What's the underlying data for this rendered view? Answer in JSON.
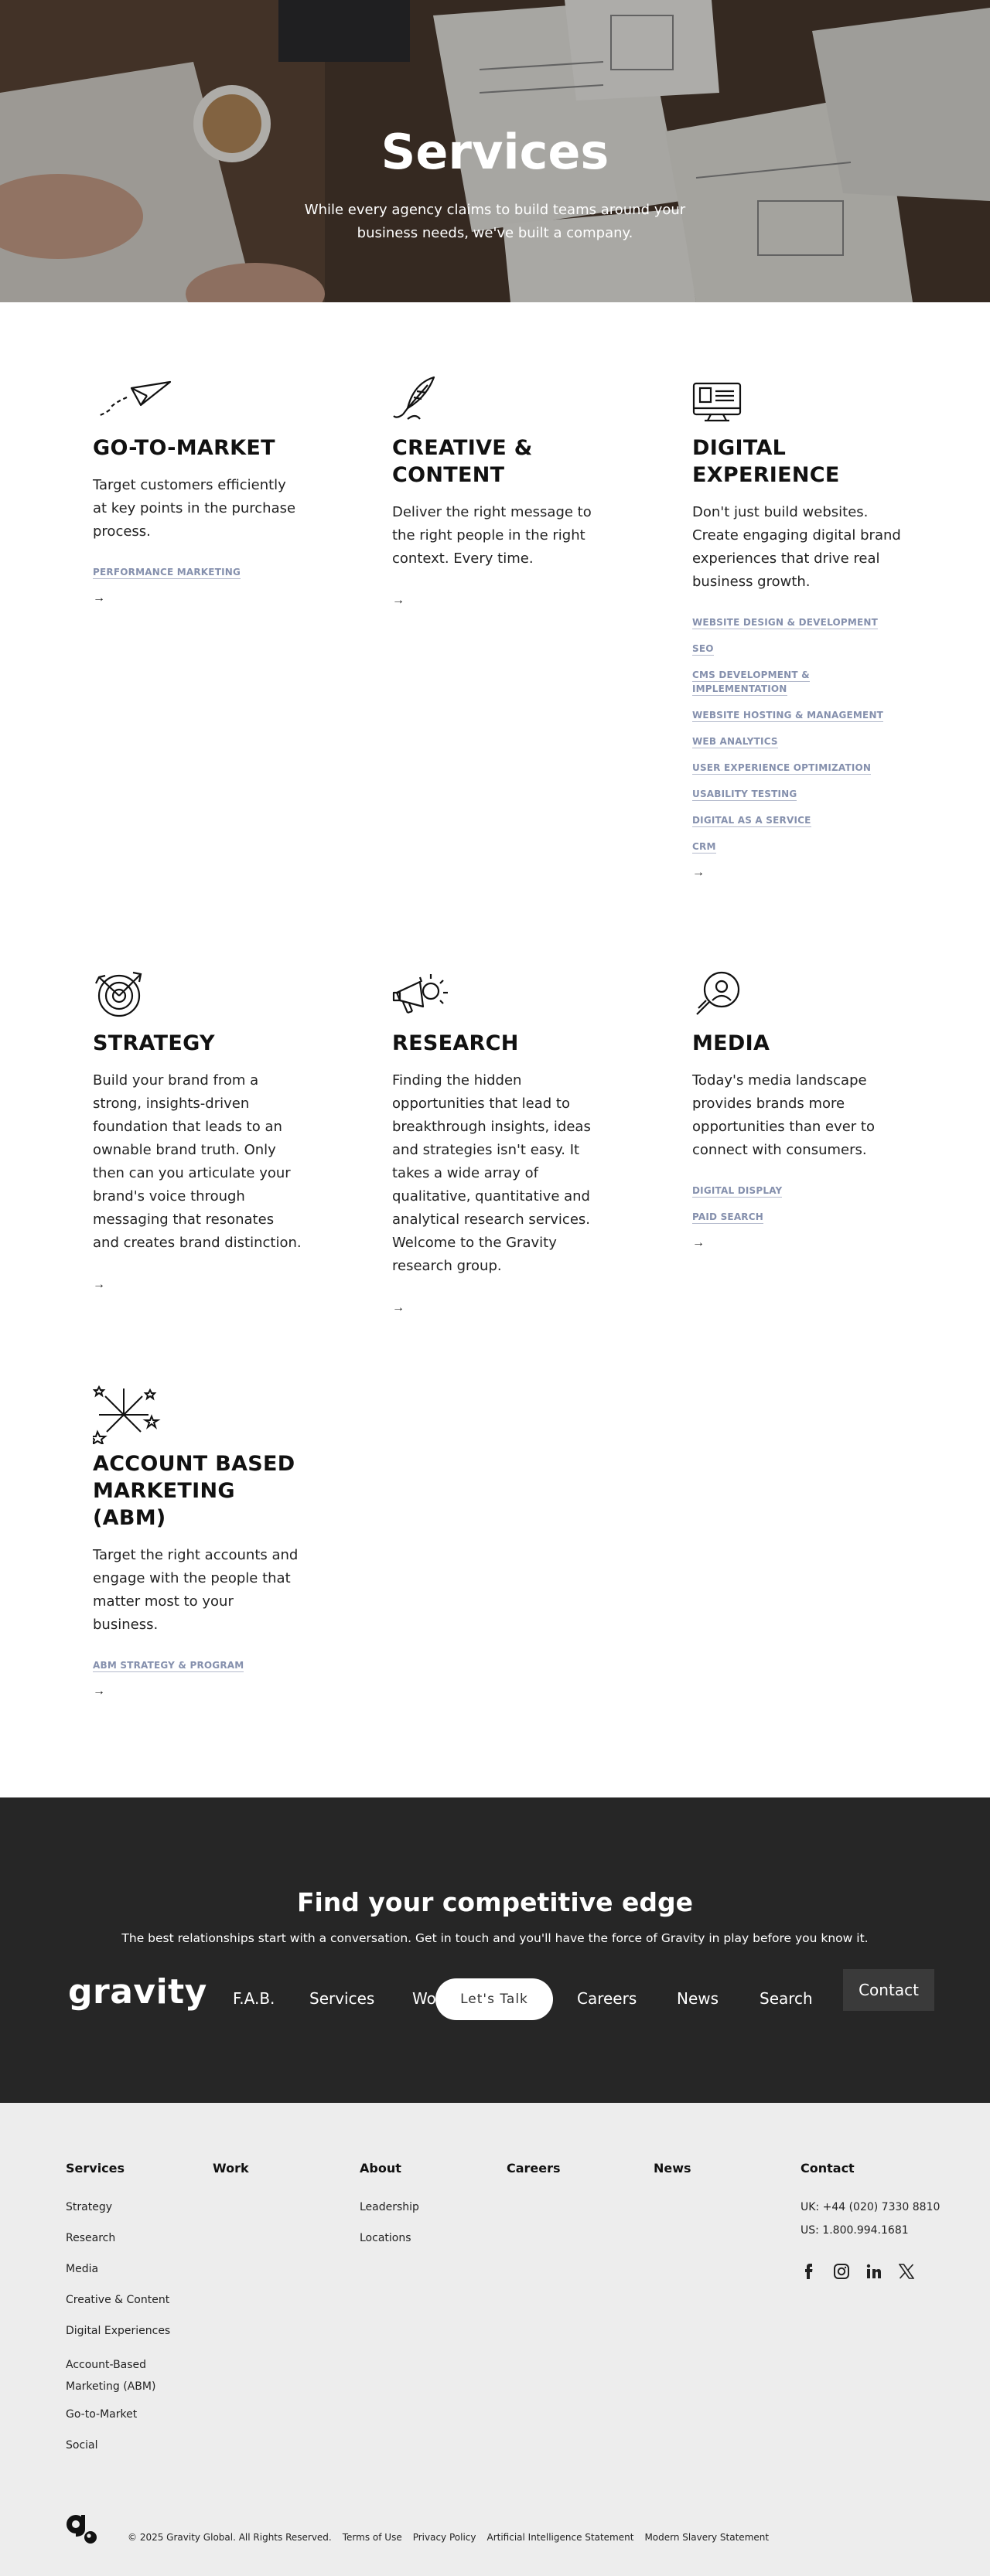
{
  "hero": {
    "title": "Services",
    "subtitle": "While every agency claims to build teams around your business needs, we've built a company."
  },
  "services": [
    {
      "title": "Go-to-Market",
      "icon": "paper-plane-icon",
      "description": "Target customers efficiently at key points in the purchase process.",
      "links": [
        "Performance Marketing"
      ]
    },
    {
      "title": "Creative & Content",
      "icon": "quill-icon",
      "description": "Deliver the right message to the right people in the right context. Every time.",
      "links": []
    },
    {
      "title": "Digital Experience",
      "icon": "monitor-icon",
      "description": "Don't just build websites. Create engaging digital brand experiences that drive real business growth.",
      "links": [
        "Website Design & Development",
        "SEO",
        "CMS Development & Implementation",
        "Website Hosting & Management",
        "Web Analytics",
        "User Experience Optimization",
        "Usability Testing",
        "Digital as a Service",
        "CRM"
      ]
    },
    {
      "title": "Strategy",
      "icon": "target-icon",
      "description": "Build your brand from a strong, insights-driven foundation that leads to an ownable brand truth. Only then can you articulate your brand's voice through messaging that resonates and creates brand distinction.",
      "links": []
    },
    {
      "title": "Research",
      "icon": "megaphone-icon",
      "description": "Finding the hidden opportunities that lead to breakthrough insights, ideas and strategies isn't easy. It takes a wide array of qualitative, quantitative and analytical research services. Welcome to the Gravity research group.",
      "links": []
    },
    {
      "title": "Media",
      "icon": "magnifier-person-icon",
      "description": "Today's media landscape provides brands more opportunities than ever to connect with consumers.",
      "links": [
        "Digital Display",
        "Paid Search"
      ]
    },
    {
      "title": "Account Based Marketing (ABM)",
      "icon": "fireworks-icon",
      "description": "Target the right accounts and engage with the people that matter most to your business.",
      "links": [
        "ABM Strategy & Program"
      ]
    }
  ],
  "arrow": "→",
  "cta": {
    "title": "Find your competitive edge",
    "text": "The best relationships start with a conversation. Get in touch and you'll have the force of Gravity in play before you know it.",
    "button": "Let's Talk"
  },
  "nav": {
    "logo": "gravity",
    "items": [
      "F.A.B.",
      "Services",
      "Wo",
      "Careers",
      "News",
      "Search"
    ],
    "contact": "Contact"
  },
  "footer": {
    "columns": {
      "services": {
        "title": "Services",
        "items": [
          "Strategy",
          "Research",
          "Media",
          "Creative & Content",
          "Digital Experiences",
          "Account-Based Marketing (ABM)",
          "Go-to-Market",
          "Social"
        ]
      },
      "work": {
        "title": "Work"
      },
      "about": {
        "title": "About",
        "items": [
          "Leadership",
          "Locations"
        ]
      },
      "careers": {
        "title": "Careers"
      },
      "news": {
        "title": "News"
      },
      "contact": {
        "title": "Contact",
        "uk": "UK: +44 (020) 7330 8810",
        "us": "US: 1.800.994.1681"
      }
    },
    "social": [
      "facebook-icon",
      "instagram-icon",
      "linkedin-icon",
      "x-icon"
    ],
    "copyright": "© 2025 Gravity Global. All Rights Reserved.",
    "legal": [
      "Terms of Use",
      "Privacy Policy",
      "Artificial Intelligence Statement",
      "Modern Slavery Statement"
    ]
  },
  "colors": {
    "link": "#8590ad",
    "cta_bg": "#262626",
    "footer_bg": "#ededed"
  }
}
